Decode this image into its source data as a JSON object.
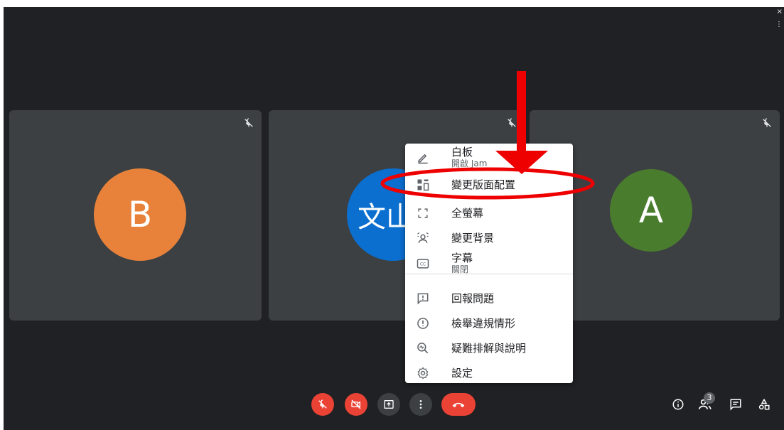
{
  "window": {
    "close_glyph": "×",
    "menu_glyph": "⋮"
  },
  "participants": [
    {
      "initial": "B",
      "color": "#e8823a",
      "mic": "muted"
    },
    {
      "initial": "文山",
      "color": "#0b6fcf",
      "mic": "muted"
    },
    {
      "initial": "A",
      "color": "#4a7c2e",
      "mic": "muted"
    }
  ],
  "menu": {
    "items": [
      {
        "label": "白板",
        "sub": "開啟 Jam",
        "icon": "pencil-icon"
      },
      {
        "label": "變更版面配置",
        "icon": "layout-icon"
      },
      {
        "label": "全螢幕",
        "icon": "fullscreen-icon"
      },
      {
        "label": "變更背景",
        "icon": "background-icon"
      },
      {
        "label": "字幕",
        "sub": "關閉",
        "icon": "captions-icon"
      },
      {
        "label": "回報問題",
        "icon": "feedback-icon"
      },
      {
        "label": "檢舉違規情形",
        "icon": "report-icon"
      },
      {
        "label": "疑難排解與說明",
        "icon": "troubleshoot-icon"
      },
      {
        "label": "設定",
        "icon": "settings-icon"
      }
    ]
  },
  "controls": {
    "mic": "mic-off-icon",
    "camera": "camera-off-icon",
    "present": "present-icon",
    "more": "more-options-icon",
    "leave": "end-call-icon"
  },
  "right_controls": {
    "participant_count": "3"
  },
  "colors": {
    "background": "#202124",
    "tile": "#3c4043",
    "danger": "#ea4335",
    "annotation": "#ee0000"
  }
}
